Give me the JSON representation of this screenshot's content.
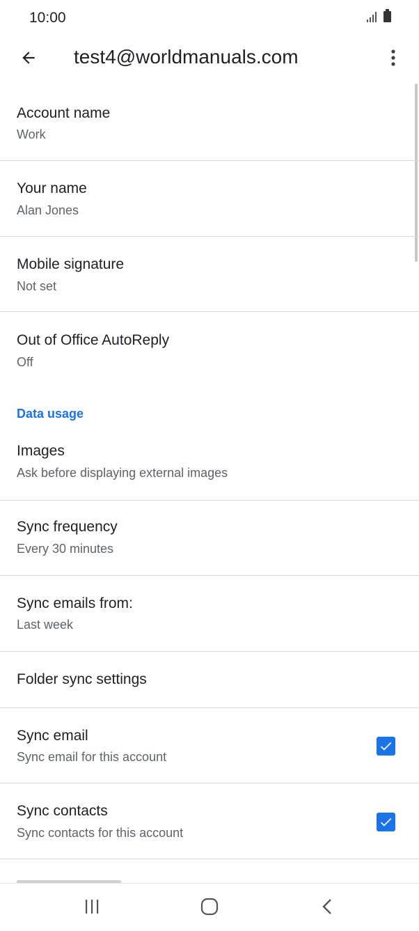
{
  "status_bar": {
    "time": "10:00",
    "icons": [
      "signal-icon",
      "battery-icon"
    ]
  },
  "app_bar": {
    "title": "test4@worldmanuals.com",
    "back_icon": "arrow-back-icon",
    "menu_icon": "more-vert-icon"
  },
  "settings": {
    "account_name": {
      "title": "Account name",
      "value": "Work"
    },
    "your_name": {
      "title": "Your name",
      "value": "Alan Jones"
    },
    "mobile_signature": {
      "title": "Mobile signature",
      "value": "Not set"
    },
    "out_of_office": {
      "title": "Out of Office AutoReply",
      "value": "Off"
    },
    "data_usage_header": "Data usage",
    "images": {
      "title": "Images",
      "value": "Ask before displaying external images"
    },
    "sync_frequency": {
      "title": "Sync frequency",
      "value": "Every 30 minutes"
    },
    "sync_emails_from": {
      "title": "Sync emails from:",
      "value": "Last week"
    },
    "folder_sync": {
      "title": "Folder sync settings"
    },
    "sync_email": {
      "title": "Sync email",
      "value": "Sync email for this account",
      "checked": true
    },
    "sync_contacts": {
      "title": "Sync contacts",
      "value": "Sync contacts for this account",
      "checked": true
    }
  },
  "colors": {
    "accent": "#1a73e8",
    "text_primary": "#202124",
    "text_secondary": "#5f6368",
    "divider": "#d9d9d9"
  },
  "nav_bar": {
    "icons": [
      "recent-apps-icon",
      "home-icon",
      "back-nav-icon"
    ]
  }
}
